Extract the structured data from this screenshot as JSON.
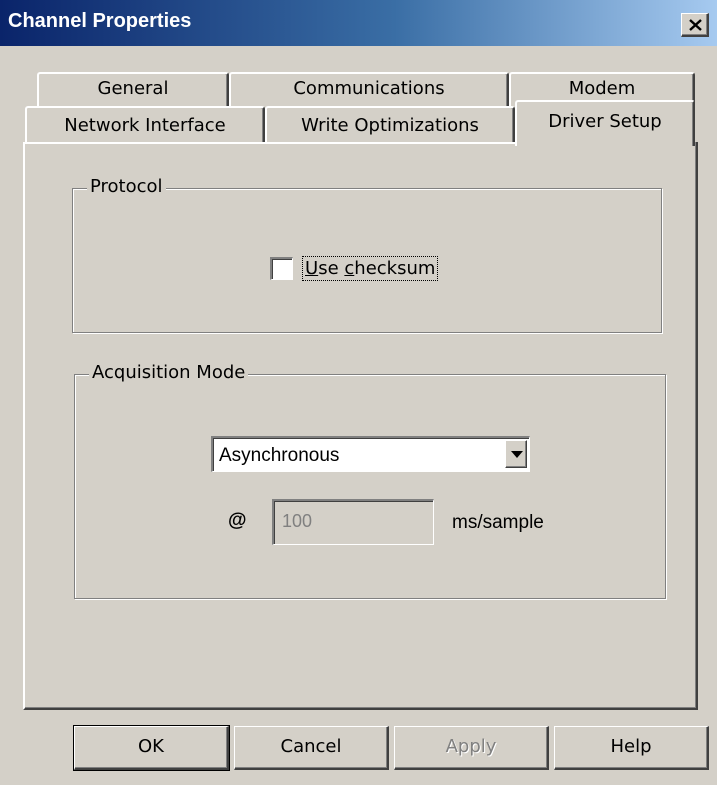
{
  "window": {
    "title": "Channel Properties"
  },
  "tabs": {
    "row1": [
      "General",
      "Communications",
      "Modem"
    ],
    "row2": [
      "Network Interface",
      "Write Optimizations"
    ],
    "active": "Driver Setup"
  },
  "protocol": {
    "group_label": "Protocol",
    "checkbox_label": "Use checksum",
    "checked": false
  },
  "acquisition": {
    "group_label": "Acquisition Mode",
    "mode_value": "Asynchronous",
    "at_symbol": "@",
    "rate_value": "100",
    "rate_unit": "ms/sample"
  },
  "buttons": {
    "ok": "OK",
    "cancel": "Cancel",
    "apply": "Apply",
    "help": "Help"
  },
  "icons": {
    "close": "close-icon",
    "dropdown": "chevron-down-icon"
  }
}
